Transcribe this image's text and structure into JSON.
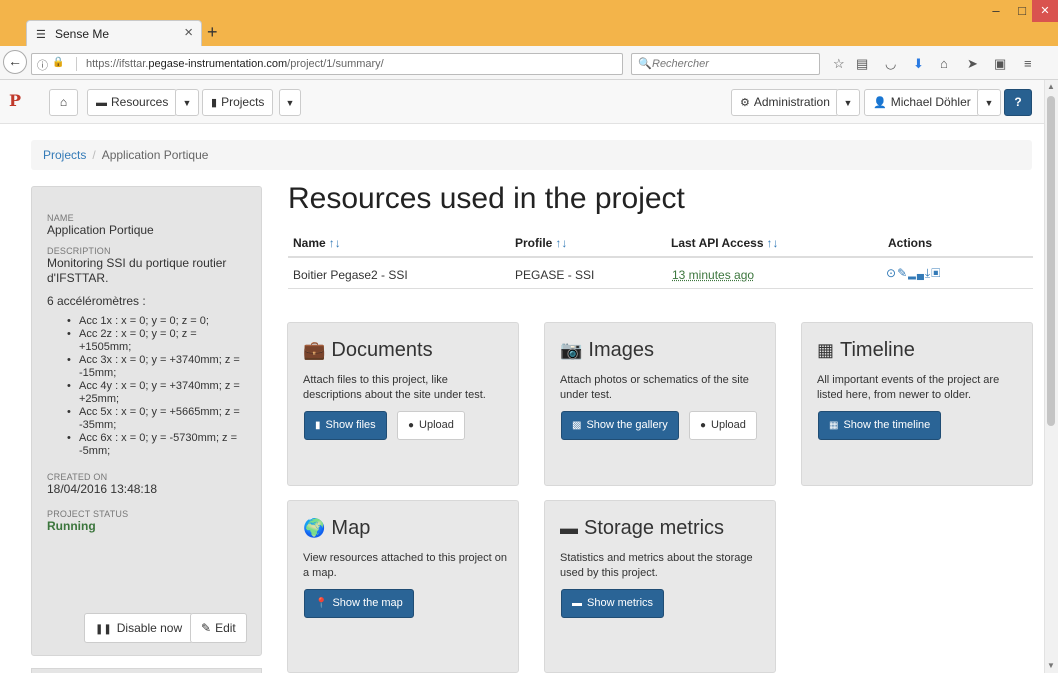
{
  "browser": {
    "tab_title": "Sense Me",
    "url_prefix": "https://ifsttar.",
    "url_domain": "pegase-instrumentation.com",
    "url_path": "/project/1/summary/",
    "search_placeholder": "Rechercher"
  },
  "nav": {
    "resources_label": "Resources",
    "projects_label": "Projects",
    "administration_label": "Administration",
    "user_label": "Michael Döhler"
  },
  "breadcrumb": {
    "projects": "Projects",
    "current": "Application Portique"
  },
  "sidebar": {
    "name_label": "NAME",
    "name_value": "Application Portique",
    "description_label": "DESCRIPTION",
    "description_value": "Monitoring SSI du portique routier d'IFSTTAR.",
    "sensors_intro": "6 accéléromètres :",
    "accelerometers": [
      "Acc 1x : x = 0; y = 0; z = 0;",
      "Acc 2z : x = 0; y = 0; z = +1505mm;",
      "Acc 3x : x = 0; y = +3740mm; z = -15mm;",
      "Acc 4y : x = 0; y = +3740mm; z = +25mm;",
      "Acc 5x : x = 0; y = +5665mm; z = -35mm;",
      "Acc 6x : x = 0; y = -5730mm; z = -5mm;"
    ],
    "created_label": "CREATED ON",
    "created_value": "18/04/2016 13:48:18",
    "status_label": "PROJECT STATUS",
    "status_value": "Running",
    "status_color": "#3c763d",
    "disable_label": "Disable now",
    "edit_label": "Edit"
  },
  "main": {
    "title": "Resources used in the project",
    "table": {
      "headers": [
        "Name",
        "Profile",
        "Last API Access",
        "Actions"
      ],
      "sort_arrows": "↑↓",
      "rows": [
        {
          "name": "Boitier Pegase2 - SSI",
          "profile": "PEGASE - SSI",
          "last_access": "13 minutes ago"
        }
      ]
    },
    "cards": {
      "documents": {
        "title": "Documents",
        "desc": "Attach files to this project, like descriptions about the site under test.",
        "btn1": "Show files",
        "btn2": "Upload"
      },
      "images": {
        "title": "Images",
        "desc": "Attach photos or schematics of the site under test.",
        "btn1": "Show the gallery",
        "btn2": "Upload"
      },
      "timeline": {
        "title": "Timeline",
        "desc": "All important events of the project are listed here, from newer to older.",
        "btn1": "Show the timeline"
      },
      "map": {
        "title": "Map",
        "desc": "View resources attached to this project on a map.",
        "btn1": "Show the map"
      },
      "storage": {
        "title": "Storage metrics",
        "desc": "Statistics and metrics about the storage used by this project.",
        "btn1": "Show metrics"
      }
    }
  },
  "colors": {
    "primary": "#2a6496",
    "link": "#337ab7",
    "titlebar": "#f3b44a"
  }
}
